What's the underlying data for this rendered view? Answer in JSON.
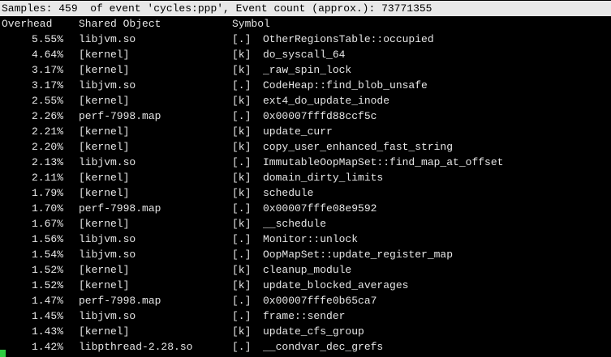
{
  "header": {
    "text": "Samples: 459  of event 'cycles:ppp', Event count (approx.): 73771355"
  },
  "columns": {
    "overhead": "Overhead",
    "shared_object": "Shared Object",
    "symbol": "Symbol"
  },
  "rows": [
    {
      "overhead": "5.55%",
      "object": "libjvm.so",
      "priv": "[.]",
      "symbol": "OtherRegionsTable::occupied"
    },
    {
      "overhead": "4.64%",
      "object": "[kernel]",
      "priv": "[k]",
      "symbol": "do_syscall_64"
    },
    {
      "overhead": "3.17%",
      "object": "[kernel]",
      "priv": "[k]",
      "symbol": "_raw_spin_lock"
    },
    {
      "overhead": "3.17%",
      "object": "libjvm.so",
      "priv": "[.]",
      "symbol": "CodeHeap::find_blob_unsafe"
    },
    {
      "overhead": "2.55%",
      "object": "[kernel]",
      "priv": "[k]",
      "symbol": "ext4_do_update_inode"
    },
    {
      "overhead": "2.26%",
      "object": "perf-7998.map",
      "priv": "[.]",
      "symbol": "0x00007fffd88ccf5c"
    },
    {
      "overhead": "2.21%",
      "object": "[kernel]",
      "priv": "[k]",
      "symbol": "update_curr"
    },
    {
      "overhead": "2.20%",
      "object": "[kernel]",
      "priv": "[k]",
      "symbol": "copy_user_enhanced_fast_string"
    },
    {
      "overhead": "2.13%",
      "object": "libjvm.so",
      "priv": "[.]",
      "symbol": "ImmutableOopMapSet::find_map_at_offset"
    },
    {
      "overhead": "2.11%",
      "object": "[kernel]",
      "priv": "[k]",
      "symbol": "domain_dirty_limits"
    },
    {
      "overhead": "1.79%",
      "object": "[kernel]",
      "priv": "[k]",
      "symbol": "schedule"
    },
    {
      "overhead": "1.70%",
      "object": "perf-7998.map",
      "priv": "[.]",
      "symbol": "0x00007fffe08e9592"
    },
    {
      "overhead": "1.67%",
      "object": "[kernel]",
      "priv": "[k]",
      "symbol": "__schedule"
    },
    {
      "overhead": "1.56%",
      "object": "libjvm.so",
      "priv": "[.]",
      "symbol": "Monitor::unlock"
    },
    {
      "overhead": "1.54%",
      "object": "libjvm.so",
      "priv": "[.]",
      "symbol": "OopMapSet::update_register_map"
    },
    {
      "overhead": "1.52%",
      "object": "[kernel]",
      "priv": "[k]",
      "symbol": "cleanup_module"
    },
    {
      "overhead": "1.52%",
      "object": "[kernel]",
      "priv": "[k]",
      "symbol": "update_blocked_averages"
    },
    {
      "overhead": "1.47%",
      "object": "perf-7998.map",
      "priv": "[.]",
      "symbol": "0x00007fffe0b65ca7"
    },
    {
      "overhead": "1.45%",
      "object": "libjvm.so",
      "priv": "[.]",
      "symbol": "frame::sender"
    },
    {
      "overhead": "1.43%",
      "object": "[kernel]",
      "priv": "[k]",
      "symbol": "update_cfs_group"
    },
    {
      "overhead": "1.42%",
      "object": "libpthread-2.28.so",
      "priv": "[.]",
      "symbol": "__condvar_dec_grefs"
    }
  ],
  "colors": {
    "background": "#000000",
    "foreground": "#e6e6e6",
    "header_bg": "#e8e8e8",
    "header_fg": "#000000",
    "cursor": "#2ecc40"
  }
}
